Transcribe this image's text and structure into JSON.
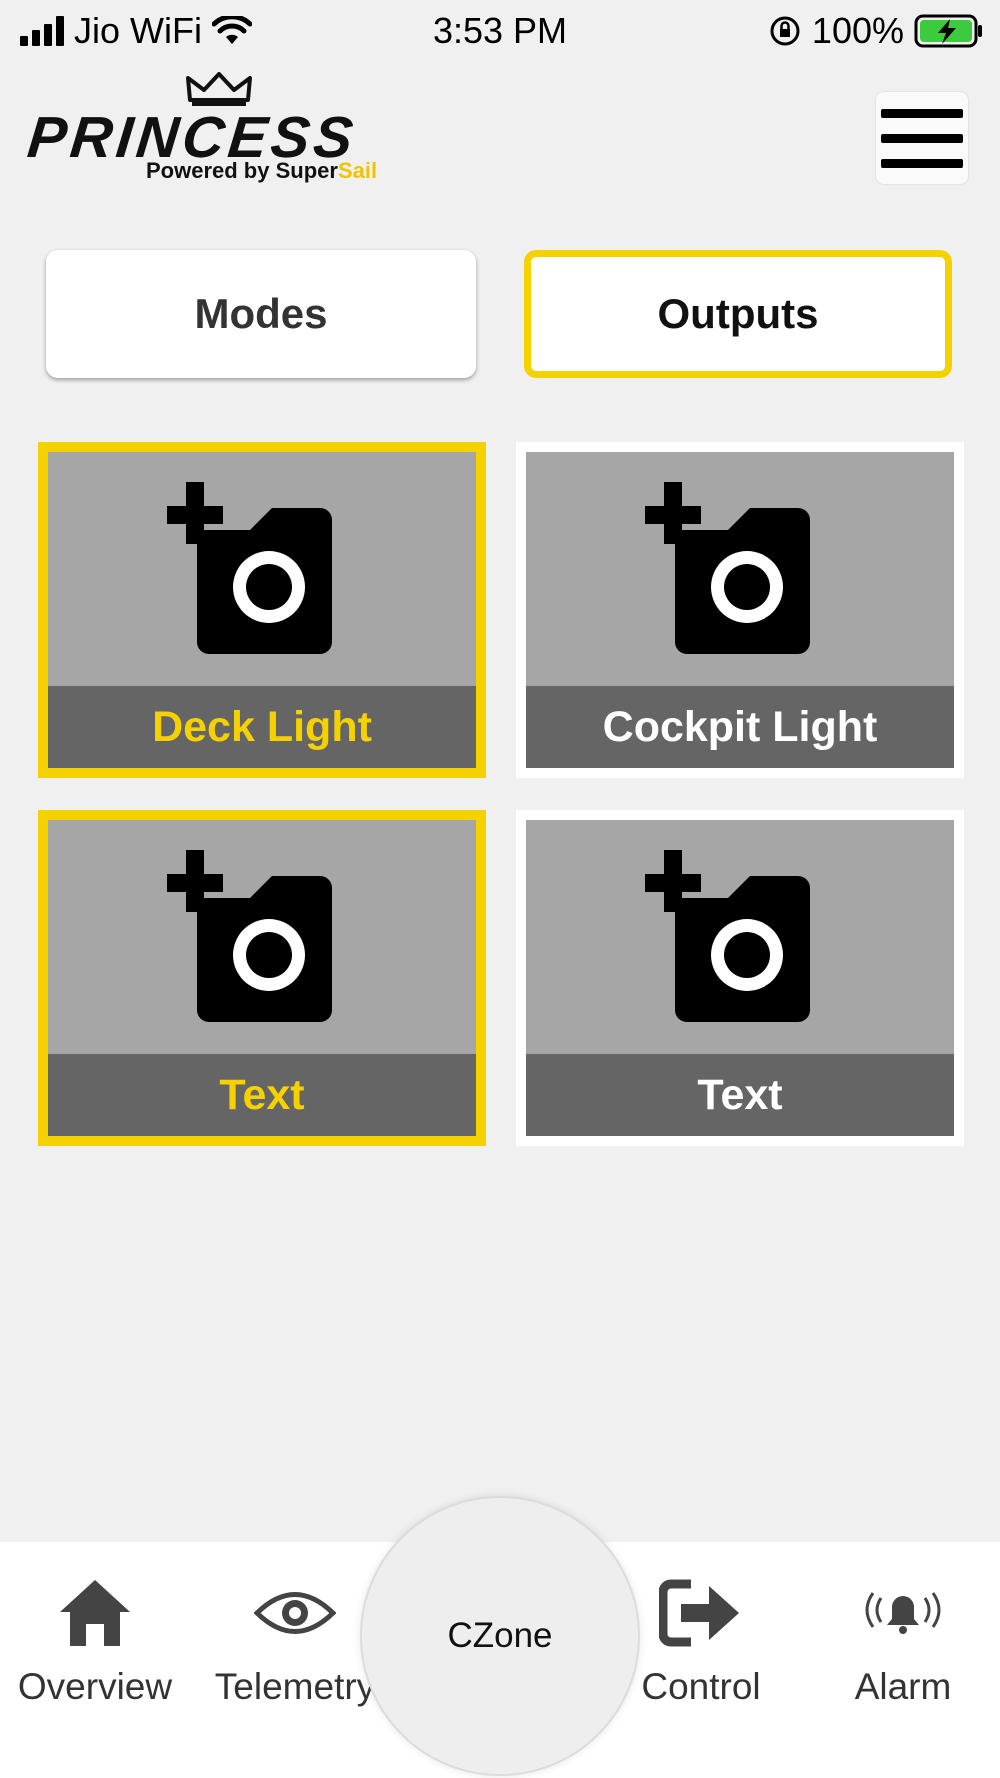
{
  "status_bar": {
    "carrier": "Jio WiFi",
    "time": "3:53 PM",
    "battery": "100%"
  },
  "header": {
    "logo_text": "PRINCESS",
    "tagline_prefix": "Powered by Super",
    "tagline_accent": "Sail",
    "menu_icon": "hamburger-menu-icon"
  },
  "segments": {
    "modes_label": "Modes",
    "outputs_label": "Outputs",
    "active": "Outputs"
  },
  "tiles": [
    {
      "label": "Deck Light",
      "selected": true,
      "icon": "add-photo-icon"
    },
    {
      "label": "Cockpit Light",
      "selected": false,
      "icon": "add-photo-icon"
    },
    {
      "label": "Text",
      "selected": true,
      "icon": "add-photo-icon"
    },
    {
      "label": "Text",
      "selected": false,
      "icon": "add-photo-icon"
    }
  ],
  "bottom_nav": {
    "overview": "Overview",
    "telemetry": "Telemetry",
    "center": "CZone",
    "control": "Control",
    "alarm": "Alarm"
  },
  "colors": {
    "accent": "#f6d100",
    "tile_bg": "#a6a6a6",
    "tile_label_bg": "#656565"
  }
}
